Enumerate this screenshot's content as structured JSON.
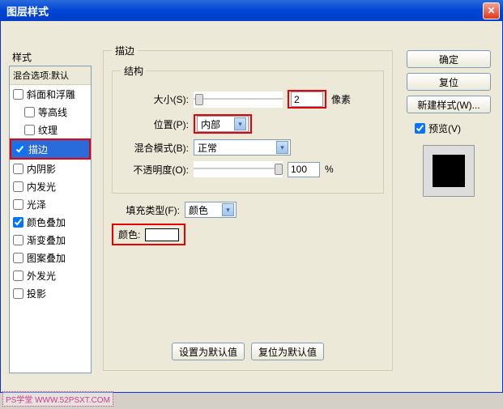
{
  "title": "图层样式",
  "left": {
    "heading": "样式",
    "blendHeader": "混合选项:默认",
    "items": [
      {
        "label": "斜面和浮雕",
        "checked": false,
        "indent": false
      },
      {
        "label": "等高线",
        "checked": false,
        "indent": true
      },
      {
        "label": "纹理",
        "checked": false,
        "indent": true
      },
      {
        "label": "描边",
        "checked": true,
        "indent": false,
        "selected": true
      },
      {
        "label": "内阴影",
        "checked": false,
        "indent": false
      },
      {
        "label": "内发光",
        "checked": false,
        "indent": false
      },
      {
        "label": "光泽",
        "checked": false,
        "indent": false
      },
      {
        "label": "颜色叠加",
        "checked": true,
        "indent": false
      },
      {
        "label": "渐变叠加",
        "checked": false,
        "indent": false
      },
      {
        "label": "图案叠加",
        "checked": false,
        "indent": false
      },
      {
        "label": "外发光",
        "checked": false,
        "indent": false
      },
      {
        "label": "投影",
        "checked": false,
        "indent": false
      }
    ]
  },
  "mid": {
    "groupTitle": "描边",
    "structTitle": "结构",
    "size": {
      "label": "大小(S):",
      "value": "2",
      "unit": "像素",
      "thumb_pct": 2
    },
    "position": {
      "label": "位置(P):",
      "value": "内部"
    },
    "blend": {
      "label": "混合模式(B):",
      "value": "正常"
    },
    "opacity": {
      "label": "不透明度(O):",
      "value": "100",
      "unit": "%",
      "thumb_pct": 100
    },
    "fillType": {
      "label": "填充类型(F):",
      "value": "颜色"
    },
    "color": {
      "label": "颜色:",
      "hex": "#ffffff"
    },
    "defaultsBtn": "设置为默认值",
    "resetBtn": "复位为默认值"
  },
  "right": {
    "ok": "确定",
    "reset": "复位",
    "newStyle": "新建样式(W)...",
    "preview": "预览(V)",
    "previewChecked": true
  },
  "watermark": "PS学堂  WWW.52PSXT.COM"
}
